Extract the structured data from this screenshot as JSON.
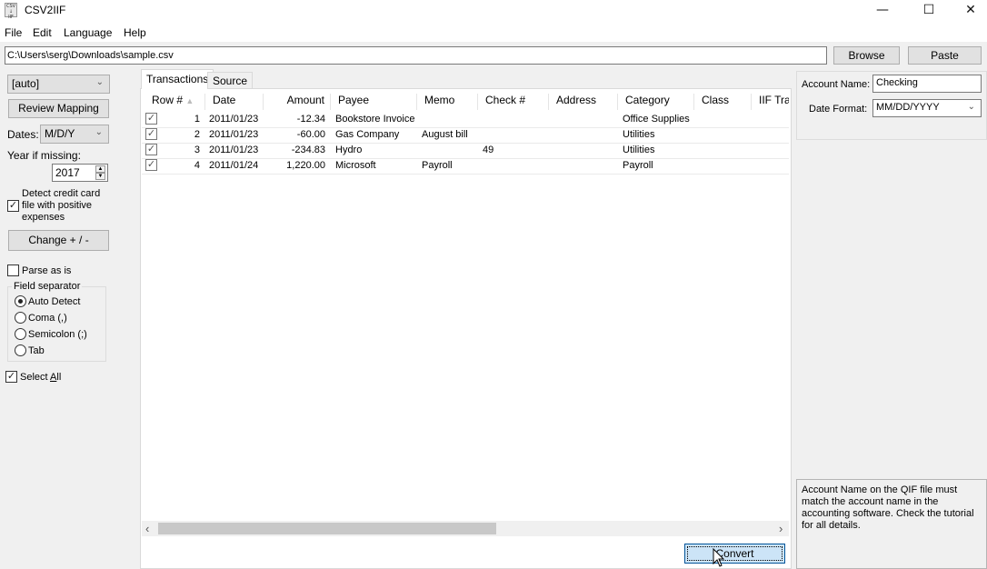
{
  "window": {
    "title": "CSV2IIF",
    "icon": "csv-iif-app-icon",
    "controls": {
      "minimize": "—",
      "maximize": "☐",
      "close": "✕"
    }
  },
  "menu": [
    "File",
    "Edit",
    "Language",
    "Help"
  ],
  "path": {
    "value": "C:\\Users\\serg\\Downloads\\sample.csv",
    "browse_label": "Browse",
    "paste_label": "Paste"
  },
  "left": {
    "mapping_combo": "[auto]",
    "review_mapping_label": "Review Mapping",
    "dates_label": "Dates:",
    "dates_value": "M/D/Y",
    "year_label": "Year if missing:",
    "year_value": "2017",
    "detect_cc_label_lines": [
      "Detect credit card",
      "file with positive",
      "expenses"
    ],
    "detect_cc_checked": true,
    "change_sign_label": "Change + / -",
    "parse_as_is_label": "Parse as is",
    "parse_as_is_checked": false,
    "field_separator_label": "Field separator",
    "separators": [
      {
        "label": "Auto Detect",
        "selected": true
      },
      {
        "label": "Coma (,)",
        "selected": false
      },
      {
        "label": "Semicolon (;)",
        "selected": false
      },
      {
        "label": "Tab",
        "selected": false
      }
    ],
    "select_all_pre": "Select ",
    "select_all_accel": "A",
    "select_all_post": "ll",
    "select_all_checked": true
  },
  "tabs": [
    {
      "label": "Transactions",
      "active": true
    },
    {
      "label": "Source",
      "active": false
    }
  ],
  "grid": {
    "columns": [
      "Row #",
      "Date",
      "Amount",
      "Payee",
      "Memo",
      "Check #",
      "Address",
      "Category",
      "Class",
      "IIF Tran"
    ],
    "sort_column": "Row #",
    "sort_direction": "ascending",
    "rows": [
      {
        "checked": true,
        "row": "1",
        "date": "2011/01/23",
        "amount": "-12.34",
        "payee": "Bookstore Invoice",
        "memo": "",
        "check": "",
        "address": "",
        "category": "Office Supplies",
        "class": "",
        "iif": ""
      },
      {
        "checked": true,
        "row": "2",
        "date": "2011/01/23",
        "amount": "-60.00",
        "payee": "Gas Company",
        "memo": "August bill",
        "check": "",
        "address": "",
        "category": "Utilities",
        "class": "",
        "iif": ""
      },
      {
        "checked": true,
        "row": "3",
        "date": "2011/01/23",
        "amount": "-234.83",
        "payee": "Hydro",
        "memo": "",
        "check": "49",
        "address": "",
        "category": "Utilities",
        "class": "",
        "iif": ""
      },
      {
        "checked": true,
        "row": "4",
        "date": "2011/01/24",
        "amount": "1,220.00",
        "payee": "Microsoft",
        "memo": "Payroll",
        "check": "",
        "address": "",
        "category": "Payroll",
        "class": "",
        "iif": ""
      }
    ],
    "scroll_left_icon": "‹",
    "scroll_right_icon": "›"
  },
  "convert_label": "Convert",
  "right": {
    "account_name_label": "Account Name:",
    "account_name_value": "Checking",
    "date_format_label": "Date Format:",
    "date_format_value": "MM/DD/YYYY",
    "info_text": "Account Name on the QIF file must match the account name in the accounting software. Check the tutorial for all details."
  }
}
